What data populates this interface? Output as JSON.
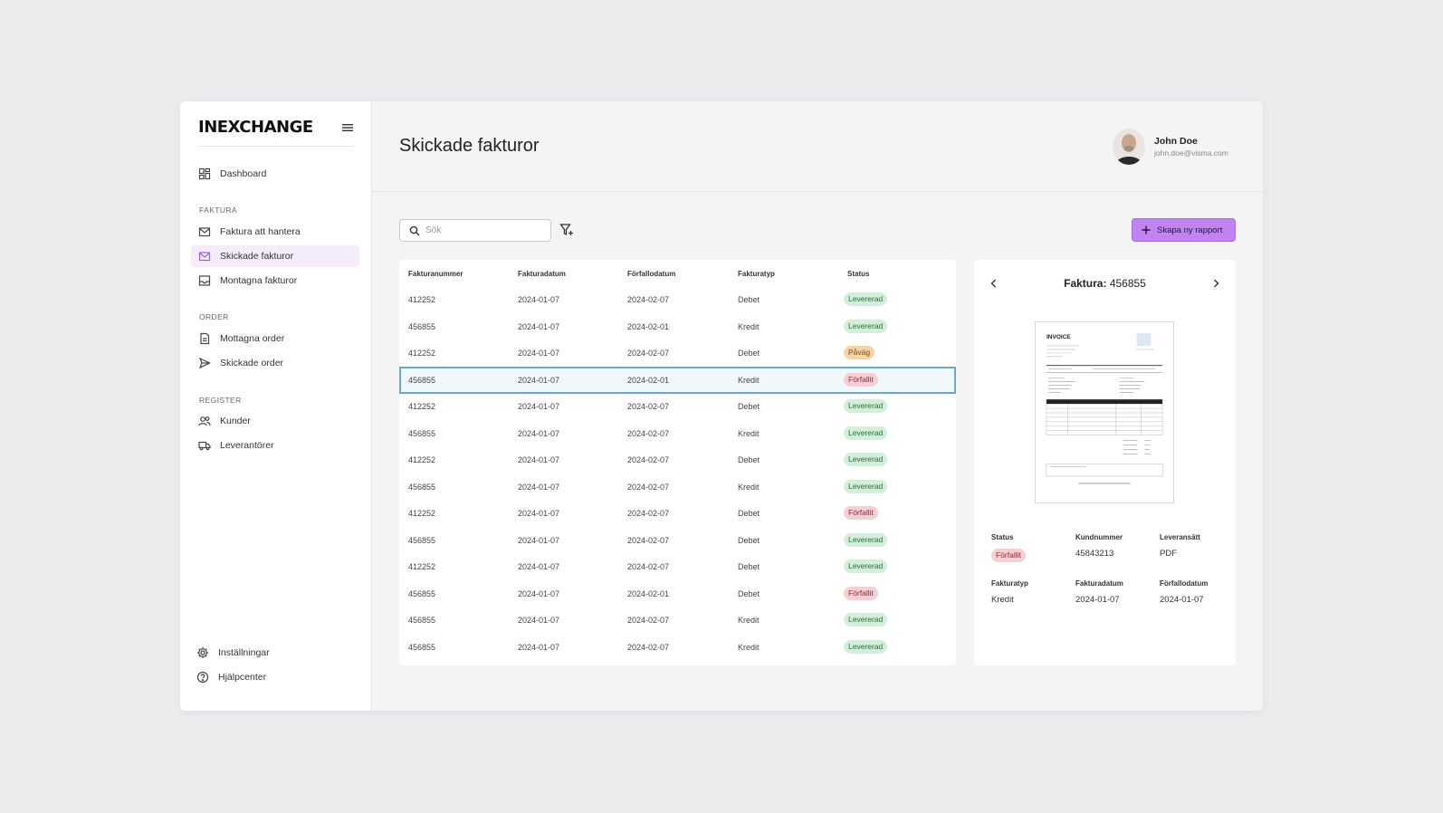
{
  "brand": {
    "logo_text": "INEXCHANGE"
  },
  "sidebar": {
    "dashboard": "Dashboard",
    "sections": {
      "faktura": "FAKTURA",
      "order": "ORDER",
      "register": "REGISTER"
    },
    "items": {
      "faktura_att_hantera": "Faktura att hantera",
      "skickade_fakturor": "Skickade fakturor",
      "montagna_fakturor": "Montagna fakturor",
      "mottagna_order": "Mottagna order",
      "skickade_order": "Skickade order",
      "kunder": "Kunder",
      "leverantorer": "Leverantörer"
    },
    "bottom": {
      "installningar": "Inställningar",
      "hjalpcenter": "Hjälpcenter"
    }
  },
  "header": {
    "title": "Skickade fakturor",
    "user_name": "John Doe",
    "user_email": "john.doe@visma.com"
  },
  "toolbar": {
    "search_placeholder": "Sök",
    "create_label": "Skapa ny rapport"
  },
  "table": {
    "columns": [
      "Fakturanummer",
      "Fakturadatum",
      "Förfallodatum",
      "Fakturatyp",
      "Status"
    ],
    "rows": [
      {
        "nr": "412252",
        "date": "2024-01-07",
        "due": "2024-02-07",
        "type": "Debet",
        "status": "Levererad",
        "kind": "ok"
      },
      {
        "nr": "456855",
        "date": "2024-01-07",
        "due": "2024-02-01",
        "type": "Kredit",
        "status": "Levererad",
        "kind": "ok"
      },
      {
        "nr": "412252",
        "date": "2024-01-07",
        "due": "2024-02-07",
        "type": "Debet",
        "status": "Påväg",
        "kind": "warn"
      },
      {
        "nr": "456855",
        "date": "2024-01-07",
        "due": "2024-02-01",
        "type": "Kredit",
        "status": "Förfallit",
        "kind": "bad"
      },
      {
        "nr": "412252",
        "date": "2024-01-07",
        "due": "2024-02-07",
        "type": "Debet",
        "status": "Levererad",
        "kind": "ok"
      },
      {
        "nr": "456855",
        "date": "2024-01-07",
        "due": "2024-02-07",
        "type": "Kredit",
        "status": "Levererad",
        "kind": "ok"
      },
      {
        "nr": "412252",
        "date": "2024-01-07",
        "due": "2024-02-07",
        "type": "Debet",
        "status": "Levererad",
        "kind": "ok"
      },
      {
        "nr": "456855",
        "date": "2024-01-07",
        "due": "2024-02-07",
        "type": "Kredit",
        "status": "Levererad",
        "kind": "ok"
      },
      {
        "nr": "412252",
        "date": "2024-01-07",
        "due": "2024-02-07",
        "type": "Debet",
        "status": "Förfallit",
        "kind": "bad"
      },
      {
        "nr": "456855",
        "date": "2024-01-07",
        "due": "2024-02-07",
        "type": "Debet",
        "status": "Levererad",
        "kind": "ok"
      },
      {
        "nr": "412252",
        "date": "2024-01-07",
        "due": "2024-02-07",
        "type": "Debet",
        "status": "Levererad",
        "kind": "ok"
      },
      {
        "nr": "456855",
        "date": "2024-01-07",
        "due": "2024-02-01",
        "type": "Debet",
        "status": "Förfallit",
        "kind": "bad"
      },
      {
        "nr": "456855",
        "date": "2024-01-07",
        "due": "2024-02-07",
        "type": "Kredit",
        "status": "Levererad",
        "kind": "ok"
      },
      {
        "nr": "456855",
        "date": "2024-01-07",
        "due": "2024-02-07",
        "type": "Kredit",
        "status": "Levererad",
        "kind": "ok"
      }
    ],
    "selected_index": 3
  },
  "detail": {
    "title_label": "Faktura:",
    "title_value": "456855",
    "invoice_heading": "INVOICE",
    "fields": {
      "status_label": "Status",
      "status_value": "Förfallit",
      "kundnummer_label": "Kundnummer",
      "kundnummer_value": "45843213",
      "leveranssatt_label": "Leveransätt",
      "leveranssatt_value": "PDF",
      "fakturatyp_label": "Fakturatyp",
      "fakturatyp_value": "Kredit",
      "fakturadatum_label": "Fakturadatum",
      "fakturadatum_value": "2024-01-07",
      "forfallodatum_label": "Förfallodatum",
      "forfallodatum_value": "2024-01-07"
    }
  },
  "colors": {
    "accent": "#c183f0",
    "active_nav": "#f4ecfb",
    "selected_row_border": "#6aa9c7",
    "status_ok": "#d4efd9",
    "status_warn": "#f6d3a6",
    "status_bad": "#f6cfd4"
  },
  "icons": {
    "dashboard": "grid-icon",
    "faktura_att_hantera": "mail-icon",
    "skickade_fakturor": "mail-icon",
    "montagna_fakturor": "inbox-icon",
    "mottagna_order": "document-icon",
    "skickade_order": "send-icon",
    "kunder": "users-icon",
    "leverantorer": "truck-icon",
    "installningar": "gear-icon",
    "hjalpcenter": "help-icon"
  }
}
